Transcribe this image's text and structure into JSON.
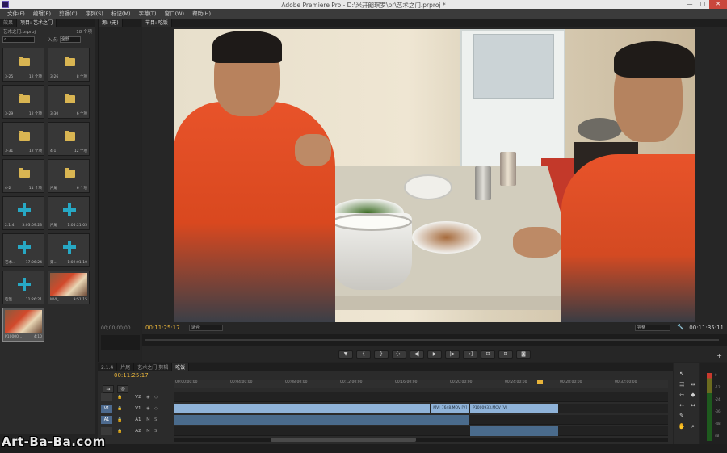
{
  "window": {
    "title": "Adobe Premiere Pro - D:\\米开朗琪罗\\pr\\艺术之门.prproj *",
    "minimize": "—",
    "maximize": "□",
    "close": "✕"
  },
  "menu": [
    {
      "label": "文件(F)"
    },
    {
      "label": "编辑(E)"
    },
    {
      "label": "剪辑(C)"
    },
    {
      "label": "序列(S)"
    },
    {
      "label": "标记(M)"
    },
    {
      "label": "字幕(T)"
    },
    {
      "label": "窗口(W)"
    },
    {
      "label": "帮助(H)"
    }
  ],
  "project": {
    "tabs": [
      {
        "label": "效果"
      },
      {
        "label": "项目: 艺术之门"
      }
    ],
    "name": "艺术之门.prproj",
    "count": "18 个项",
    "entry_label": "入点:",
    "entry_value": "全部",
    "search_placeholder": "",
    "bins": [
      {
        "name": "3-25",
        "meta": "12 个项",
        "kind": "folder"
      },
      {
        "name": "3-26",
        "meta": "8 个项",
        "kind": "folder"
      },
      {
        "name": "3-29",
        "meta": "12 个项",
        "kind": "folder"
      },
      {
        "name": "3-30",
        "meta": "6 个项",
        "kind": "folder"
      },
      {
        "name": "3-31",
        "meta": "12 个项",
        "kind": "folder"
      },
      {
        "name": "4-1",
        "meta": "12 个项",
        "kind": "folder"
      },
      {
        "name": "4-2",
        "meta": "11 个项",
        "kind": "folder"
      },
      {
        "name": "片尾",
        "meta": "6 个项",
        "kind": "folder"
      },
      {
        "name": "2.1.4",
        "meta": "3:03:09:23",
        "kind": "sequence"
      },
      {
        "name": "片尾",
        "meta": "1:05:21:05",
        "kind": "sequence"
      },
      {
        "name": "艺术...",
        "meta": "17:06:24",
        "kind": "sequence"
      },
      {
        "name": "第...",
        "meta": "1:02:01:10",
        "kind": "sequence"
      },
      {
        "name": "吃饭",
        "meta": "11:26:21",
        "kind": "sequence"
      },
      {
        "name": "MVI_...",
        "meta": "9:51:15",
        "kind": "clip"
      },
      {
        "name": "P10000...",
        "meta": "4:10",
        "kind": "clip"
      }
    ],
    "bottom_add": "+"
  },
  "source": {
    "tab": "源: (无)",
    "timecode": "00;00;00;00"
  },
  "program": {
    "tab": "节目: 吃饭",
    "timecode": "00:11:25:17",
    "fit": "适合",
    "quality": "完整",
    "duration": "00:11:35:11",
    "transport": [
      {
        "label": "▼",
        "name": "add-marker-button"
      },
      {
        "label": "{",
        "name": "mark-in-button"
      },
      {
        "label": "}",
        "name": "mark-out-button"
      },
      {
        "label": "{←",
        "name": "go-to-in-button"
      },
      {
        "label": "◀|",
        "name": "step-back-button"
      },
      {
        "label": "▶",
        "name": "play-button"
      },
      {
        "label": "|▶",
        "name": "step-forward-button"
      },
      {
        "label": "→}",
        "name": "go-to-out-button"
      },
      {
        "label": "⊡",
        "name": "lift-button"
      },
      {
        "label": "⊞",
        "name": "extract-button"
      },
      {
        "label": "◙",
        "name": "export-frame-button"
      }
    ],
    "add_button": "+"
  },
  "timeline": {
    "tabs": [
      {
        "label": "2.1.4"
      },
      {
        "label": "片尾"
      },
      {
        "label": "艺术之门 剪辑"
      },
      {
        "label": "吃饭"
      }
    ],
    "timecode": "00:11:25:17",
    "ruler": [
      "00:00:00:00",
      "00:04:00:00",
      "00:08:00:00",
      "00:12:00:00",
      "00:16:00:00",
      "00:20:00:00",
      "00:24:00:00",
      "00:28:00:00",
      "00:32:00:00"
    ],
    "tracks": [
      {
        "name": "V2",
        "target": "",
        "type": "video",
        "clips": []
      },
      {
        "name": "V1",
        "target": "V1",
        "type": "video",
        "clips": [
          {
            "label": "",
            "start": 0.0,
            "end": 0.52
          },
          {
            "label": "MVI_7648.MOV [V]",
            "start": 0.52,
            "end": 0.6
          },
          {
            "label": "P1000933.MOV [V]",
            "start": 0.6,
            "end": 0.78
          }
        ]
      },
      {
        "name": "A1",
        "target": "A1",
        "type": "audio",
        "clips": [
          {
            "label": "",
            "start": 0.0,
            "end": 0.6
          }
        ]
      },
      {
        "name": "A2",
        "target": "",
        "type": "audio",
        "clips": [
          {
            "label": "",
            "start": 0.6,
            "end": 0.78
          }
        ]
      }
    ],
    "playhead": 0.74
  },
  "watermark": "Art-Ba-Ba.com",
  "meter_labels": [
    "0",
    "-12",
    "-24",
    "-36",
    "-48",
    "dB"
  ]
}
